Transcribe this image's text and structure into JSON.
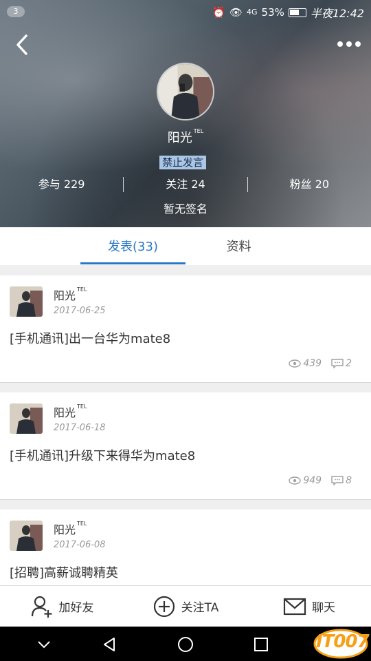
{
  "status_bar": {
    "badge": "3",
    "signal_text": "4G",
    "battery": "53%",
    "time": "半夜12:42"
  },
  "profile": {
    "username": "阳光",
    "username_tag": "TEL",
    "banned_label": "禁止发言",
    "stats": {
      "participate": "参与 229",
      "following": "关注 24",
      "fans": "粉丝 20"
    },
    "signature": "暂无签名"
  },
  "tabs": [
    {
      "label": "发表(33)",
      "active": true
    },
    {
      "label": "资料",
      "active": false
    }
  ],
  "posts": [
    {
      "user": "阳光",
      "tag": "TEL",
      "date": "2017-06-25",
      "title": "[手机通讯]出一台华为mate8",
      "views": "439",
      "comments": "2"
    },
    {
      "user": "阳光",
      "tag": "TEL",
      "date": "2017-06-18",
      "title": "[手机通讯]升级下来得华为mate8",
      "views": "949",
      "comments": "8"
    },
    {
      "user": "阳光",
      "tag": "TEL",
      "date": "2017-06-08",
      "title": "[招聘]高薪诚聘精英",
      "views": "",
      "comments": ""
    }
  ],
  "actions": {
    "add_friend": "加好友",
    "follow": "关注TA",
    "chat": "聊天"
  },
  "watermark": "IT007",
  "colors": {
    "accent": "#2a78c2",
    "banned_bg": "#a9c6e6",
    "logo": "#f6a018"
  }
}
